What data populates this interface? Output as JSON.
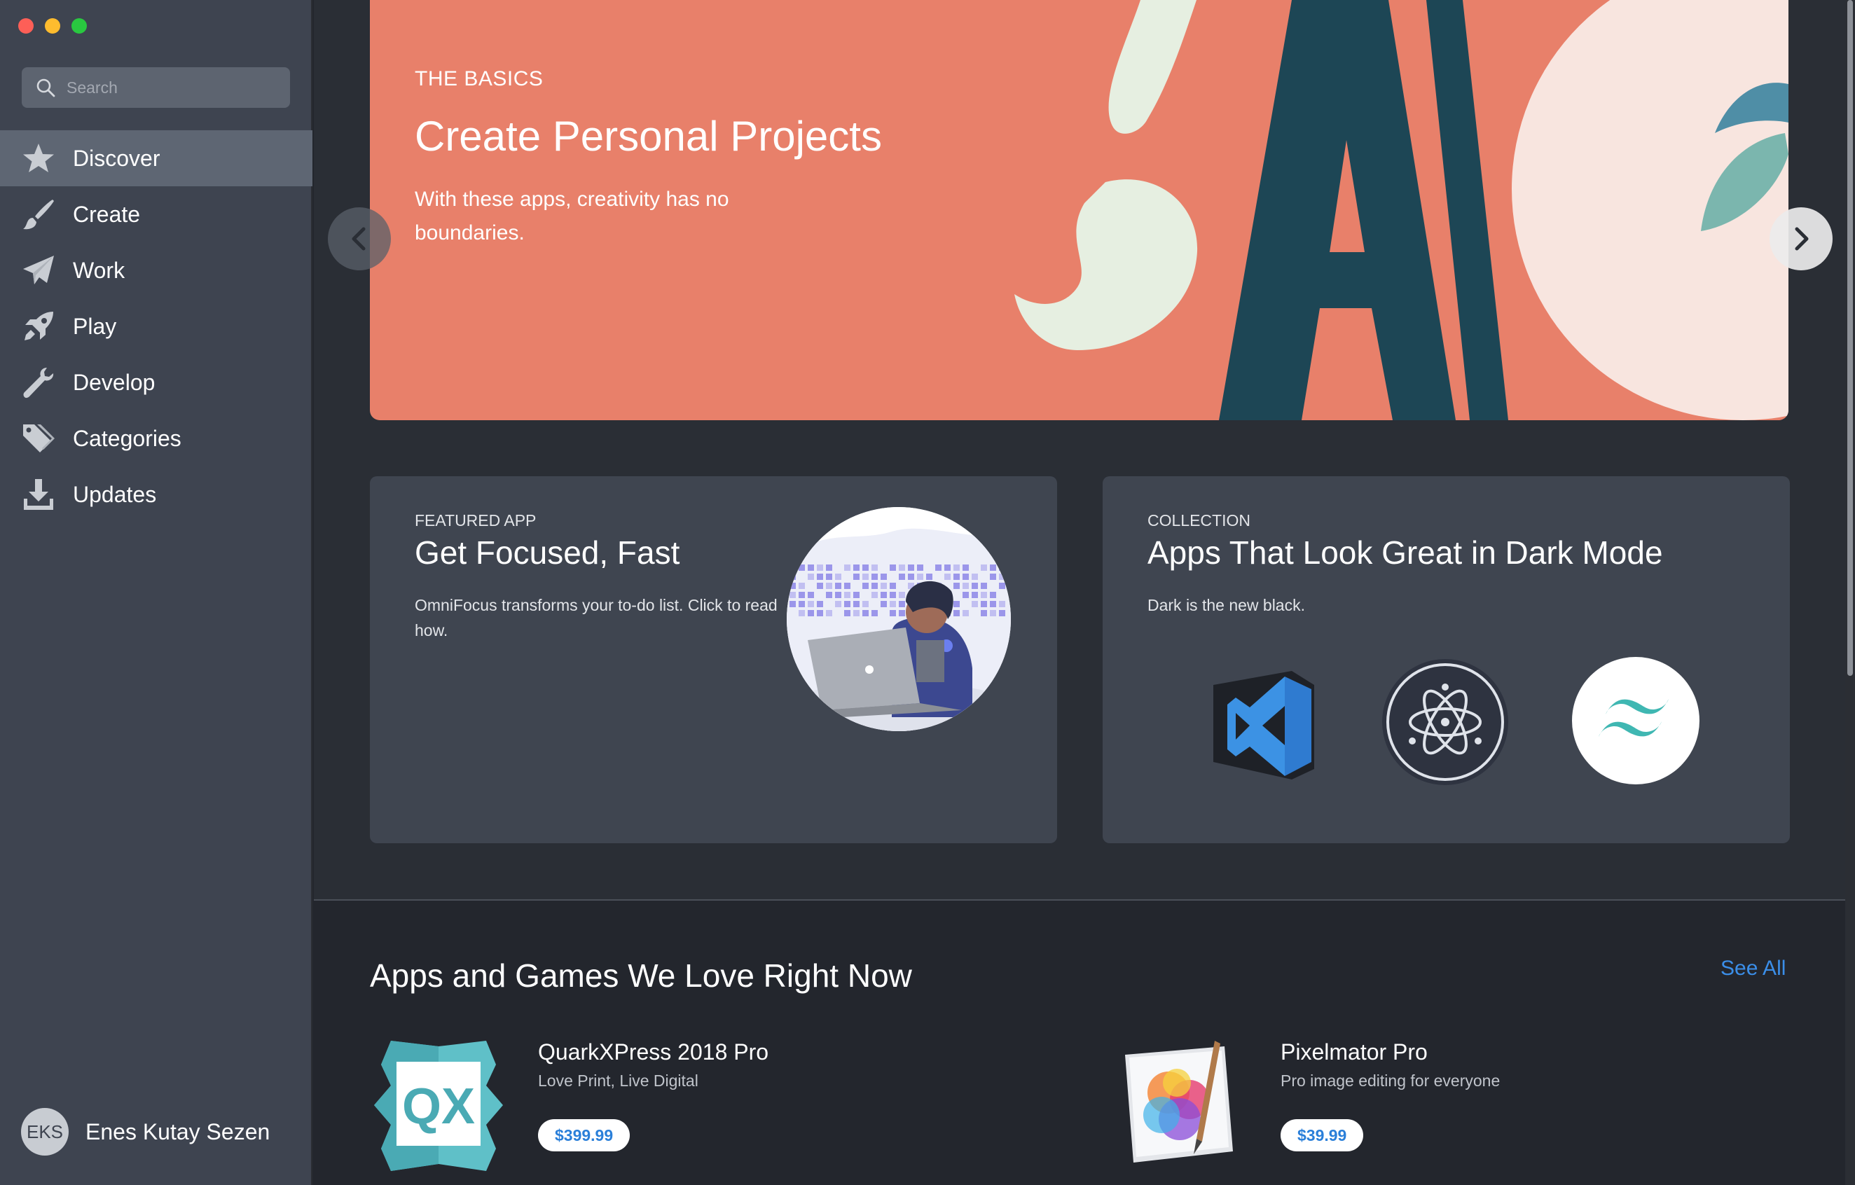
{
  "window": {
    "traffic_lights": [
      "close",
      "minimize",
      "maximize"
    ]
  },
  "sidebar": {
    "search_placeholder": "Search",
    "items": [
      {
        "label": "Discover",
        "icon": "star-icon",
        "active": true
      },
      {
        "label": "Create",
        "icon": "paintbrush-icon",
        "active": false
      },
      {
        "label": "Work",
        "icon": "paper-plane-icon",
        "active": false
      },
      {
        "label": "Play",
        "icon": "rocket-icon",
        "active": false
      },
      {
        "label": "Develop",
        "icon": "wrench-icon",
        "active": false
      },
      {
        "label": "Categories",
        "icon": "tags-icon",
        "active": false
      },
      {
        "label": "Updates",
        "icon": "download-icon",
        "active": false
      }
    ],
    "user": {
      "initials": "EKS",
      "name": "Enes Kutay Sezen"
    }
  },
  "hero": {
    "eyebrow": "THE BASICS",
    "title": "Create Personal Projects",
    "subtitle": "With these apps, creativity has no boundaries.",
    "background": "#e8806a"
  },
  "cards": {
    "featured": {
      "eyebrow": "FEATURED APP",
      "title": "Get Focused, Fast",
      "description": "OmniFocus transforms your to-do list. Click to read how."
    },
    "collection": {
      "eyebrow": "COLLECTION",
      "title": "Apps That Look Great in Dark Mode",
      "description": "Dark is the new black.",
      "app_icons": [
        "vscode-icon",
        "electron-icon",
        "tailwind-icon"
      ]
    }
  },
  "section": {
    "title": "Apps and Games We Love Right Now",
    "see_all": "See All",
    "apps": [
      {
        "name": "QuarkXPress 2018 Pro",
        "tagline": "Love Print, Live Digital",
        "price": "$399.99",
        "icon": "quarkxpress-icon"
      },
      {
        "name": "Pixelmator Pro",
        "tagline": "Pro image editing for everyone",
        "price": "$39.99",
        "icon": "pixelmator-icon"
      }
    ]
  },
  "colors": {
    "accent": "#3b8ee8",
    "sidebar": "#3e4450",
    "main": "#23262d"
  }
}
